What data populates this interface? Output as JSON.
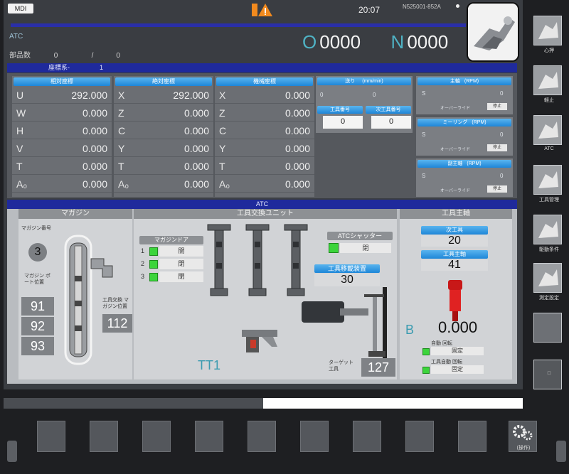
{
  "header": {
    "mode": "MDI",
    "time": "20:07",
    "serial": "N525001-852A",
    "atc_label": "ATC",
    "count_label": "部品数",
    "count_value": "0",
    "count_sep": "/",
    "count_total": "0",
    "o_label": "O",
    "o_value": "0000",
    "n_label": "N",
    "n_value": "0000"
  },
  "coord_bar": {
    "label": "座標系-",
    "value": "1"
  },
  "relative": {
    "title": "相対座標",
    "rows": [
      {
        "axis": "U",
        "value": "292.000"
      },
      {
        "axis": "W",
        "value": "0.000"
      },
      {
        "axis": "H",
        "value": "0.000"
      },
      {
        "axis": "V",
        "value": "0.000"
      },
      {
        "axis": "T",
        "value": "0.000"
      },
      {
        "axis": "A₀",
        "value": "0.000"
      }
    ]
  },
  "absolute": {
    "title": "絶対座標",
    "rows": [
      {
        "axis": "X",
        "value": "292.000"
      },
      {
        "axis": "Z",
        "value": "0.000"
      },
      {
        "axis": "C",
        "value": "0.000"
      },
      {
        "axis": "Y",
        "value": "0.000"
      },
      {
        "axis": "T",
        "value": "0.000"
      },
      {
        "axis": "A₀",
        "value": "0.000"
      }
    ]
  },
  "machine": {
    "title": "機械座標",
    "rows": [
      {
        "axis": "X",
        "value": "0.000"
      },
      {
        "axis": "Z",
        "value": "0.000"
      },
      {
        "axis": "C",
        "value": "0.000"
      },
      {
        "axis": "Y",
        "value": "0.000"
      },
      {
        "axis": "T",
        "value": "0.000"
      },
      {
        "axis": "A₀",
        "value": "0.000"
      }
    ]
  },
  "feed": {
    "title": "送り",
    "unit": "(mm/min)",
    "v1": "0",
    "v2": "0",
    "tool_no_title": "工具番号",
    "tool_no_value": "0",
    "next_tool_title": "次工具番号",
    "next_tool_value": "0"
  },
  "spindles": [
    {
      "title": "主軸",
      "unit": "(RPM)",
      "s_label": "S",
      "s_value": "0",
      "override_label": "オーバーライド",
      "status": "停止"
    },
    {
      "title": "ミーリング",
      "unit": "(RPM)",
      "s_label": "S",
      "s_value": "0",
      "override_label": "オーバーライド",
      "status": "停止"
    },
    {
      "title": "副主軸",
      "unit": "(RPM)",
      "s_label": "S",
      "s_value": "0",
      "override_label": "オーバーライド",
      "status": "停止"
    }
  ],
  "atc_bar": {
    "label": "ATC"
  },
  "magazine": {
    "title": "マガジン",
    "number_label": "マガジン番号",
    "number_value": "3",
    "ref_label": "マガジン ポート位置",
    "slots": [
      "91",
      "92",
      "93"
    ],
    "tool_change_label": "工具交換 マガジン位置",
    "tool_change_value": "112"
  },
  "exchange": {
    "title": "工具交換ユニット",
    "door_title": "マガジンドア",
    "doors": [
      {
        "num": "1",
        "state": "開"
      },
      {
        "num": "2",
        "state": "閉"
      },
      {
        "num": "3",
        "state": "閉"
      }
    ],
    "shutter_label": "ATCシャッター",
    "shutter_state": "閉",
    "transfer_label": "工具移載装置",
    "transfer_value": "30",
    "unit_name": "TT1",
    "target_label": "ターゲット 工具",
    "target_value": "127"
  },
  "tool_spindle": {
    "title": "工具主軸",
    "next_tool_label": "次工具",
    "next_tool_value": "20",
    "tool_spindle_label": "工具主軸",
    "tool_spindle_value": "41",
    "axis_label": "B",
    "axis_value": "0.000",
    "clamp1_label": "自動 回転",
    "clamp1_state": "固定",
    "clamp2_label": "工具自動 回転",
    "clamp2_state": "固定"
  },
  "sidebar": [
    {
      "label": "心押"
    },
    {
      "label": "軽止"
    },
    {
      "label": "ATC"
    },
    {
      "label": "工具管理"
    },
    {
      "label": "駆動条件"
    },
    {
      "label": "測定設定"
    },
    {
      "label": ""
    },
    {
      "label": "□"
    }
  ],
  "bottom": {
    "settings_label": "(操作)"
  },
  "colors": {
    "accent": "#1f2a9c",
    "cyan": "#4fb2c4",
    "green": "#3bd43b",
    "red": "#d42020"
  }
}
